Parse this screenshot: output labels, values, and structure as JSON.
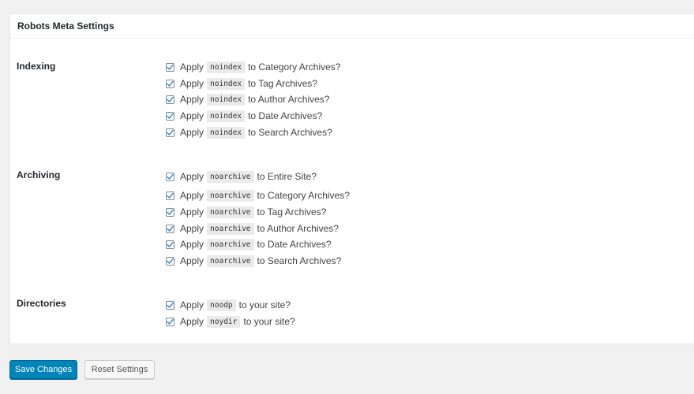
{
  "panel": {
    "title": "Robots Meta Settings"
  },
  "sections": {
    "indexing": {
      "title": "Indexing",
      "options": [
        {
          "prefix": "Apply",
          "code": "noindex",
          "suffix": "to Category Archives?",
          "checked": true
        },
        {
          "prefix": "Apply",
          "code": "noindex",
          "suffix": "to Tag Archives?",
          "checked": true
        },
        {
          "prefix": "Apply",
          "code": "noindex",
          "suffix": "to Author Archives?",
          "checked": true
        },
        {
          "prefix": "Apply",
          "code": "noindex",
          "suffix": "to Date Archives?",
          "checked": true
        },
        {
          "prefix": "Apply",
          "code": "noindex",
          "suffix": "to Search Archives?",
          "checked": true
        }
      ]
    },
    "archiving": {
      "title": "Archiving",
      "options": [
        {
          "prefix": "Apply",
          "code": "noarchive",
          "suffix": "to Entire Site?",
          "checked": true
        },
        {
          "prefix": "Apply",
          "code": "noarchive",
          "suffix": "to Category Archives?",
          "checked": true
        },
        {
          "prefix": "Apply",
          "code": "noarchive",
          "suffix": "to Tag Archives?",
          "checked": true
        },
        {
          "prefix": "Apply",
          "code": "noarchive",
          "suffix": "to Author Archives?",
          "checked": true
        },
        {
          "prefix": "Apply",
          "code": "noarchive",
          "suffix": "to Date Archives?",
          "checked": true
        },
        {
          "prefix": "Apply",
          "code": "noarchive",
          "suffix": "to Search Archives?",
          "checked": true
        }
      ]
    },
    "directories": {
      "title": "Directories",
      "options": [
        {
          "prefix": "Apply",
          "code": "noodp",
          "suffix": "to your site?",
          "checked": true
        },
        {
          "prefix": "Apply",
          "code": "noydir",
          "suffix": "to your site?",
          "checked": true
        }
      ]
    }
  },
  "buttons": {
    "save_label": "Save Changes",
    "reset_label": "Reset Settings"
  },
  "colors": {
    "primary": "#0085ba",
    "checkmark": "#4a90c8",
    "code_background": "#eaeaea"
  }
}
